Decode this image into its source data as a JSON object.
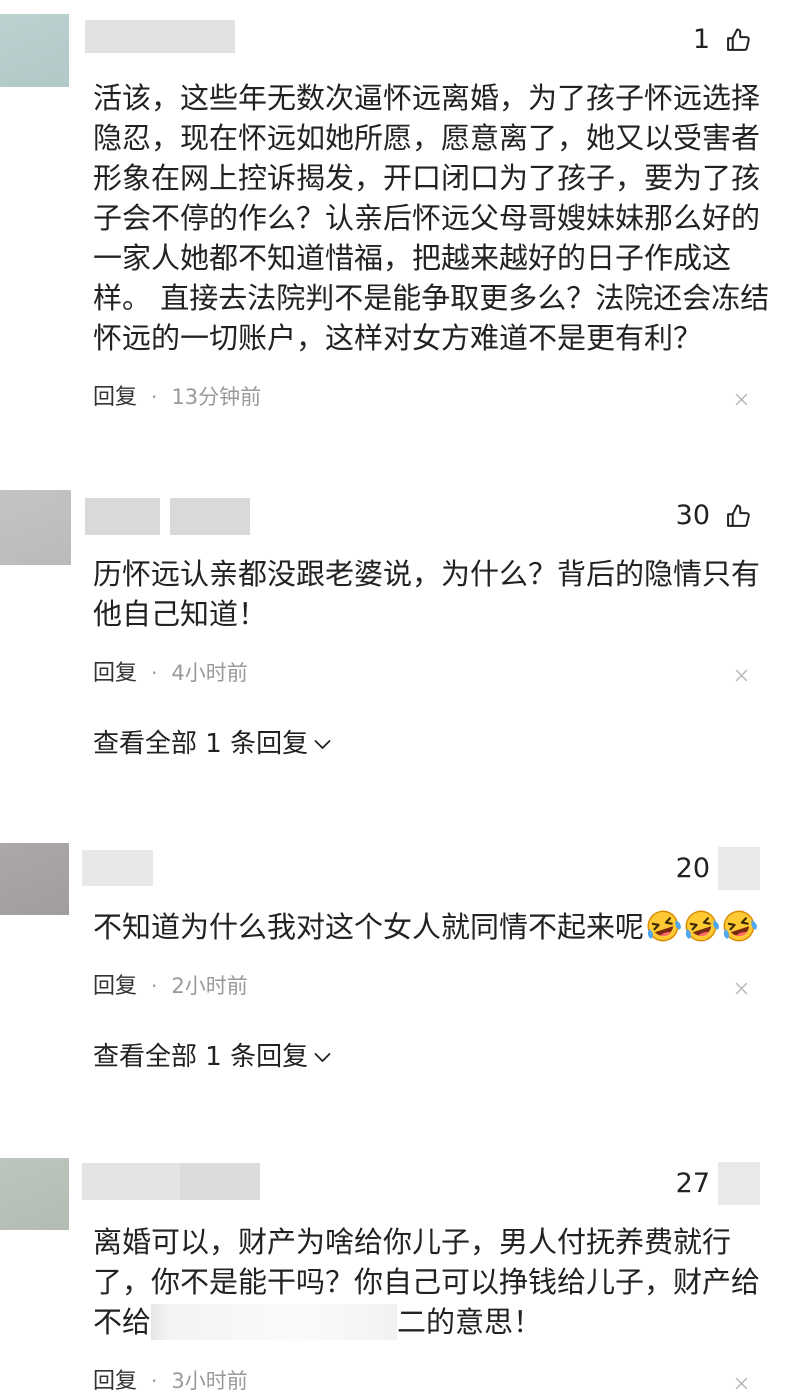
{
  "comments": [
    {
      "like_count": "1",
      "body_lines": [
        "活该，这些年无数次逼怀远离婚，为了孩子怀远选择",
        "隐忍，现在怀远如她所愿，愿意离了，她又以受害者",
        "形象在网上控诉揭发，开口闭口为了孩子，要为了孩",
        "子会不停的作么？认亲后怀远父母哥嫂妹妹那么好的",
        "一家人她都不知道惜福，把越来越好的日子作成这",
        "样。 直接去法院判不是能争取更多么？法院还会冻结",
        "怀远的一切账户，这样对女方难道不是更有利？"
      ],
      "reply_label": "回复",
      "separator": "·",
      "time": "13分钟前"
    },
    {
      "like_count": "30",
      "body_lines": [
        "历怀远认亲都没跟老婆说，为什么？背后的隐情只有",
        "他自己知道！"
      ],
      "reply_label": "回复",
      "separator": "·",
      "time": "4小时前",
      "view_replies": "查看全部 1 条回复"
    },
    {
      "like_count": "20",
      "body_lines": [
        "不知道为什么我对这个女人就同情不起来呢"
      ],
      "emojis": [
        "laughing-crying-emoji",
        "laughing-crying-emoji",
        "laughing-crying-emoji"
      ],
      "reply_label": "回复",
      "separator": "·",
      "time": "2小时前",
      "view_replies": "查看全部 1 条回复"
    },
    {
      "like_count": "27",
      "body_lines": [
        "离婚可以，财产为啥给你儿子，男人付抚养费就行",
        "了，你不是能干吗？你自己可以挣钱给儿子，财产给"
      ],
      "redacted_line": {
        "before": "不给",
        "after": "二的意思！"
      },
      "reply_label": "回复",
      "separator": "·",
      "time": "3小时前"
    }
  ],
  "icons": {
    "like": "thumbs-up-icon",
    "close": "close-icon",
    "expand": "chevron-down-icon",
    "emoji": "laughing-crying-emoji"
  },
  "colors": {
    "text": "#222222",
    "muted": "#9a9a9a",
    "redaction": "#e2e2e2"
  }
}
